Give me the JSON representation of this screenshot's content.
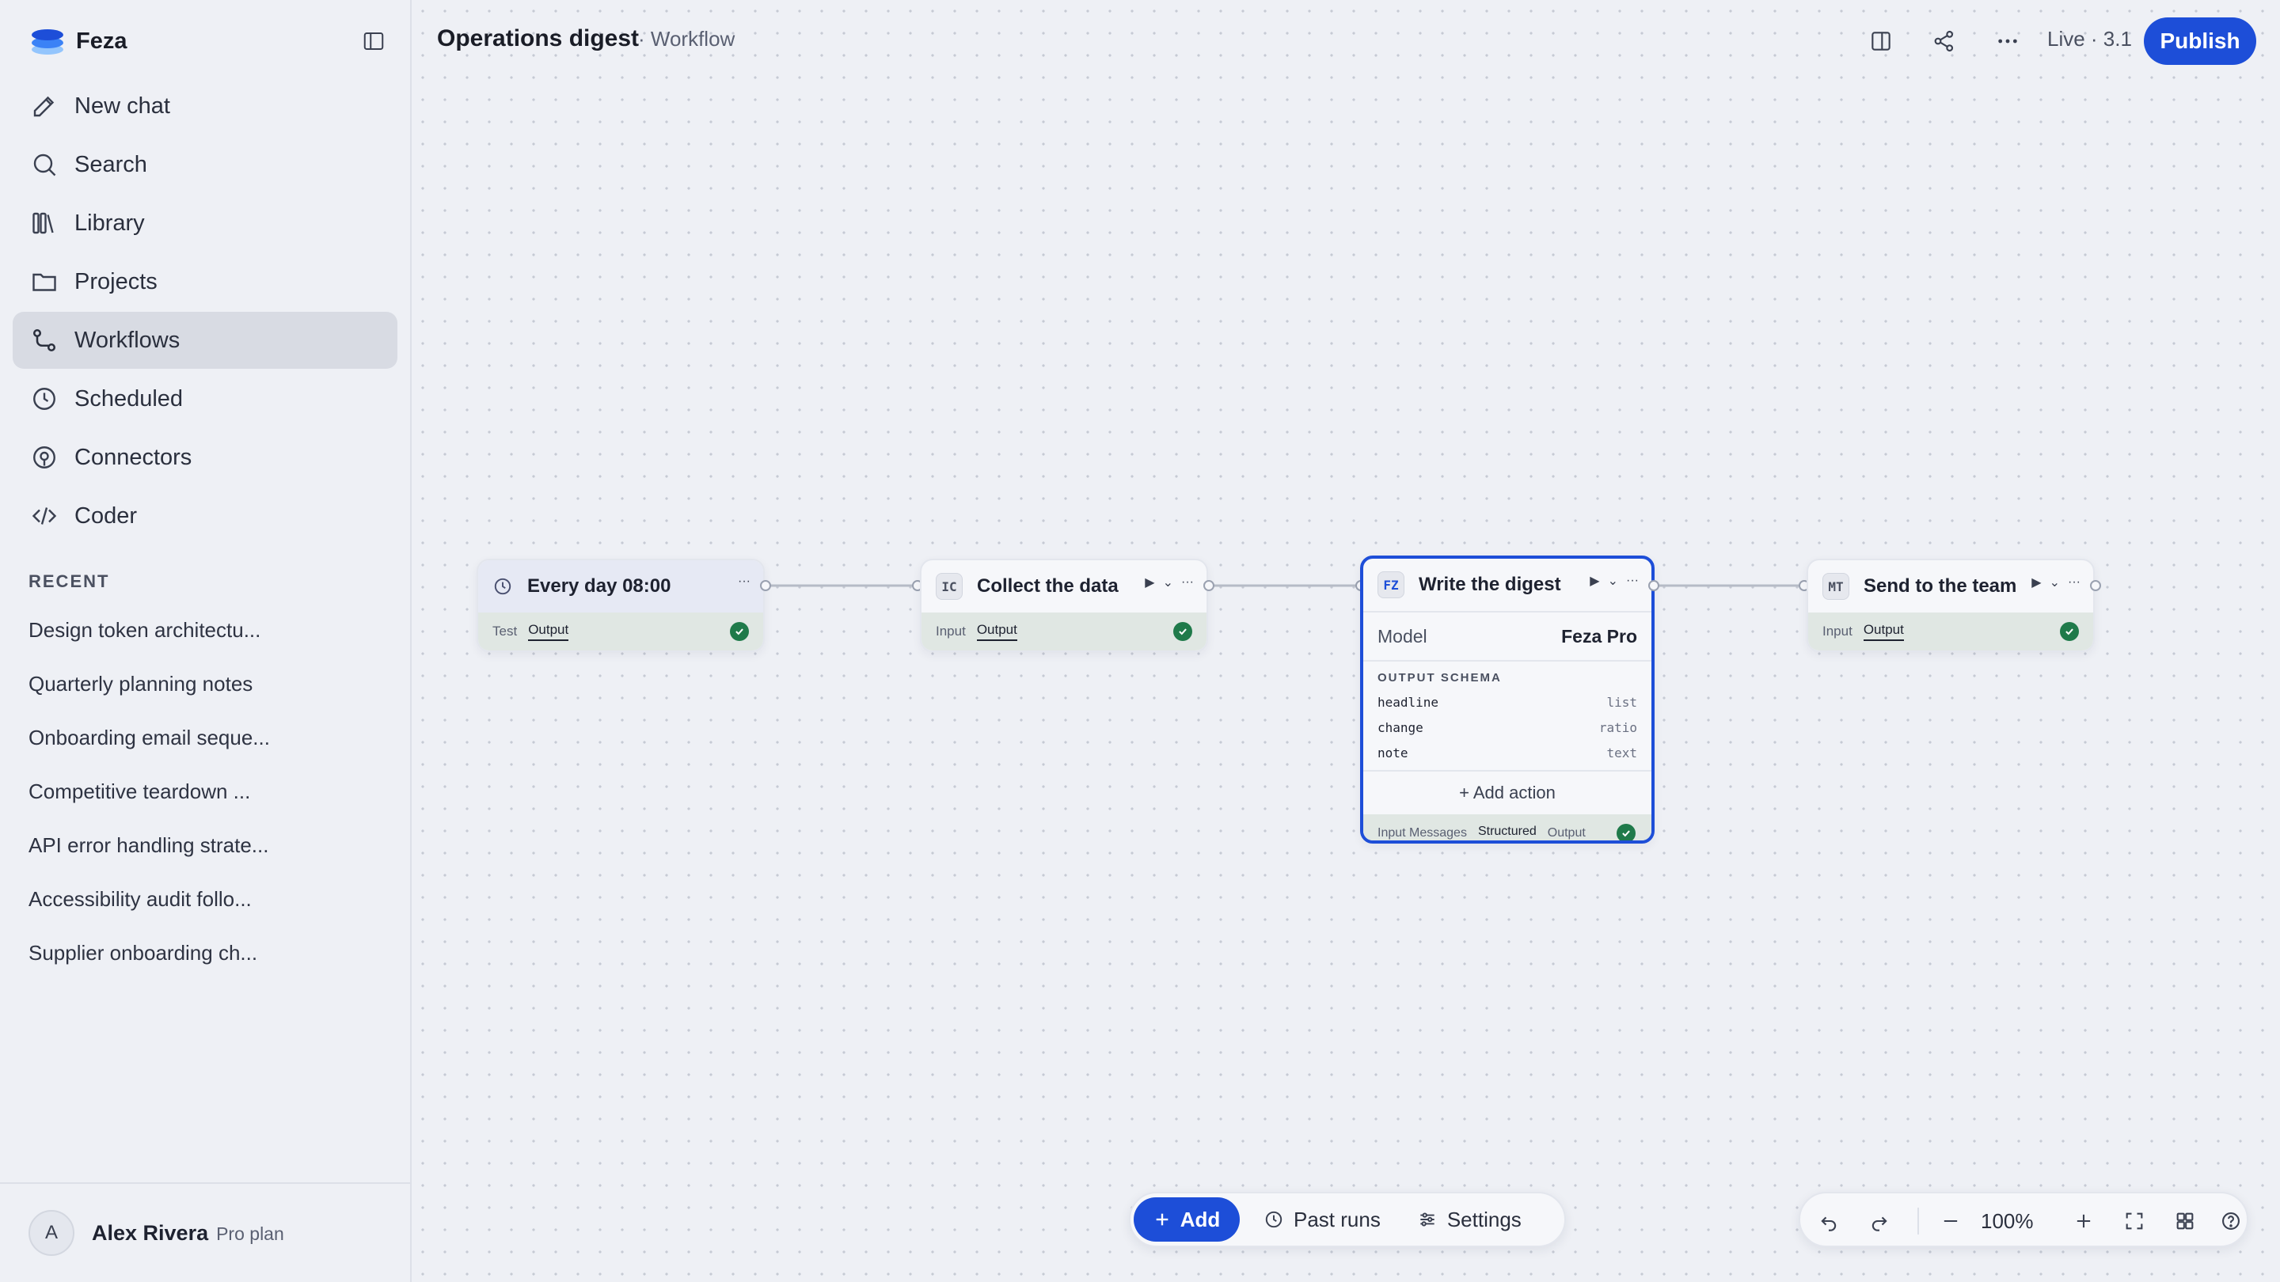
{
  "sidebar": {
    "brand": "Feza",
    "nav": [
      {
        "label": "New chat",
        "icon": "pencil-icon"
      },
      {
        "label": "Search",
        "icon": "search-icon"
      },
      {
        "label": "Library",
        "icon": "library-icon"
      },
      {
        "label": "Projects",
        "icon": "folder-icon"
      },
      {
        "label": "Workflows",
        "icon": "workflow-icon",
        "active": true
      },
      {
        "label": "Scheduled",
        "icon": "clock-icon"
      },
      {
        "label": "Connectors",
        "icon": "connector-icon"
      },
      {
        "label": "Coder",
        "icon": "code-icon"
      }
    ],
    "recent_title": "RECENT",
    "recent": [
      "Design token architectu...",
      "Quarterly planning notes",
      "Onboarding email seque...",
      "Competitive teardown ...",
      "API error handling strate...",
      "Accessibility audit follo...",
      "Supplier onboarding ch..."
    ],
    "user": {
      "initial": "A",
      "name": "Alex Rivera",
      "plan": "Pro plan"
    }
  },
  "header": {
    "title": "Operations digest",
    "subtitle": "· Workflow",
    "live": "Live · 3.1",
    "publish": "Publish"
  },
  "nodes": {
    "trigger": {
      "title": "Every day 08:00",
      "icon": "clock-icon",
      "tools": "···",
      "foot_left": "Test",
      "foot_sel": "Output"
    },
    "collect": {
      "badge": "IC",
      "title": "Collect the data",
      "foot_left": "Input",
      "foot_sel": "Output"
    },
    "digest": {
      "badge": "FZ",
      "title": "Write the digest",
      "model_label": "Model",
      "model_value": "Feza Pro",
      "schema_title": "OUTPUT SCHEMA",
      "schema": [
        {
          "key": "headline",
          "type": "list"
        },
        {
          "key": "change",
          "type": "ratio"
        },
        {
          "key": "note",
          "type": "text"
        }
      ],
      "add_action": "+ Add action",
      "foot_left": "Input Messages",
      "foot_sel": "Structured",
      "foot_right": "Output"
    },
    "send": {
      "badge": "MT",
      "title": "Send to the team",
      "foot_left": "Input",
      "foot_sel": "Output"
    }
  },
  "bottom": {
    "add": "Add",
    "past_runs": "Past runs",
    "settings": "Settings"
  },
  "zoom": {
    "value": "100%"
  },
  "colors": {
    "accent": "#1d4ed8",
    "success": "#1f7a4a",
    "background": "#eef0f5"
  }
}
